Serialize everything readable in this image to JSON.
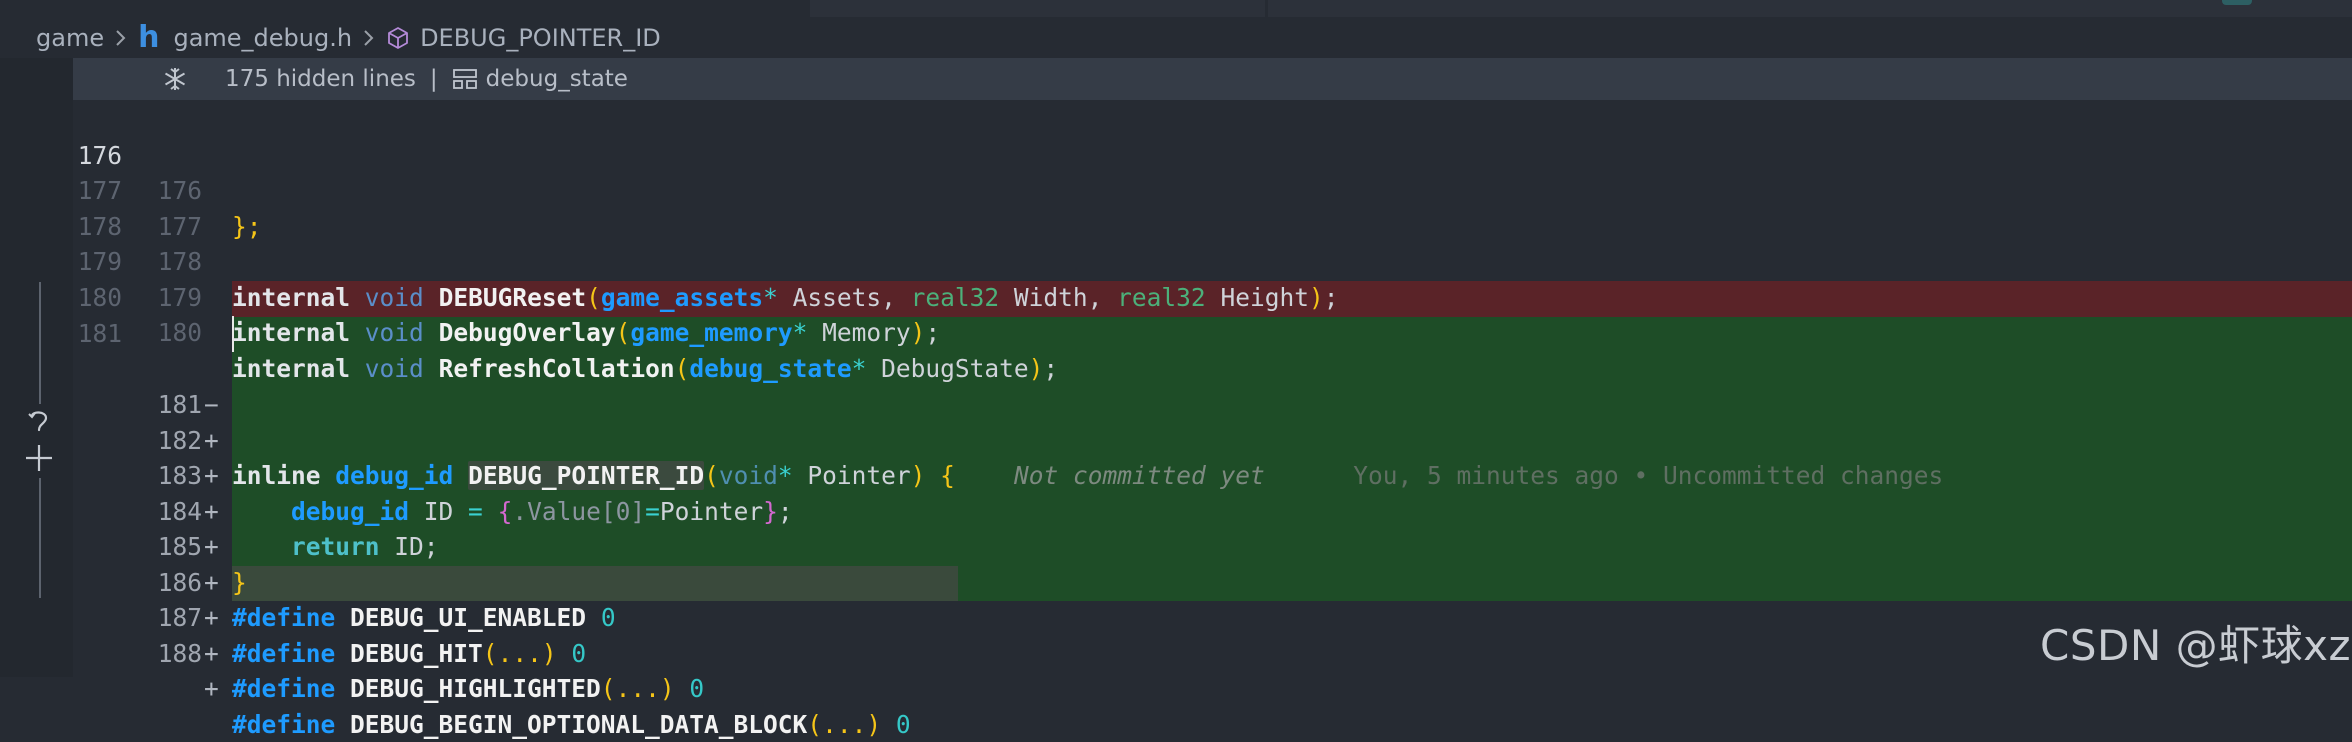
{
  "breadcrumb": {
    "folder": "game",
    "file": "game_debug.h",
    "symbol": "DEBUG_POINTER_ID"
  },
  "sticky": {
    "hidden_lines": "175 hidden lines",
    "separator": "|",
    "context": "debug_state"
  },
  "lines": [
    {
      "old": "176",
      "new": "176",
      "mark": "",
      "status": "unchanged"
    },
    {
      "old": "177",
      "new": "177",
      "mark": "",
      "status": "unchanged"
    },
    {
      "old": "178",
      "new": "178",
      "mark": "",
      "status": "unchanged"
    },
    {
      "old": "179",
      "new": "179",
      "mark": "",
      "status": "unchanged"
    },
    {
      "old": "180",
      "new": "180",
      "mark": "",
      "status": "unchanged"
    },
    {
      "old": "181",
      "new": "",
      "mark": "−",
      "status": "removed"
    },
    {
      "old": "",
      "new": "181",
      "mark": "+",
      "status": "added"
    },
    {
      "old": "",
      "new": "182",
      "mark": "+",
      "status": "added"
    },
    {
      "old": "",
      "new": "183",
      "mark": "+",
      "status": "added"
    },
    {
      "old": "",
      "new": "184",
      "mark": "+",
      "status": "added"
    },
    {
      "old": "",
      "new": "185",
      "mark": "+",
      "status": "added"
    },
    {
      "old": "",
      "new": "186",
      "mark": "+",
      "status": "added"
    },
    {
      "old": "",
      "new": "187",
      "mark": "+",
      "status": "added"
    },
    {
      "old": "",
      "new": "188",
      "mark": "+",
      "status": "added"
    }
  ],
  "code": {
    "l176": "};",
    "l178": {
      "kw": "internal",
      "void": "void",
      "fn": "DEBUGReset",
      "t1": "game_assets",
      "a1": " Assets, ",
      "r1": "real32",
      "a2": " Width, ",
      "r2": "real32",
      "a3": " Height"
    },
    "l179": {
      "kw": "internal",
      "void": "void",
      "fn": "DebugOverlay",
      "t1": "game_memory",
      "a1": " Memory"
    },
    "l180": {
      "kw": "internal",
      "void": "void",
      "fn": "RefreshCollation",
      "t1": "debug_state",
      "a1": " DebugState"
    },
    "l181": {
      "kw": "inline",
      "type": "debug_id",
      "fn": "DEBUG_POINTER_ID",
      "void": "void",
      "param": " Pointer"
    },
    "l182": {
      "type": "debug_id",
      "id": " ID ",
      "op": "=",
      "field": ".Value[0]",
      "eq": "=",
      "val": "Pointer"
    },
    "l183": {
      "kw": "return",
      "id": " ID;"
    },
    "l184": "}",
    "l185": {
      "def": "#define",
      "name": "DEBUG_UI_ENABLED",
      "val": "0"
    },
    "l186": {
      "def": "#define",
      "name": "DEBUG_HIT",
      "args": "...",
      "val": "0"
    },
    "l187": {
      "def": "#define",
      "name": "DEBUG_HIGHLIGHTED",
      "args": "...",
      "val": "0"
    },
    "l188": {
      "def": "#define",
      "name": "DEBUG_BEGIN_OPTIONAL_DATA_BLOCK",
      "args": "...",
      "val": "0"
    }
  },
  "blame": {
    "status": "Not committed yet",
    "detail": "You, 5 minutes ago • Uncommitted changes"
  },
  "watermark": "CSDN @虾球xz",
  "colors": {
    "removed_bg": "#5a2328",
    "added_bg": "#1e4d27",
    "editor_bg": "#262b33"
  }
}
